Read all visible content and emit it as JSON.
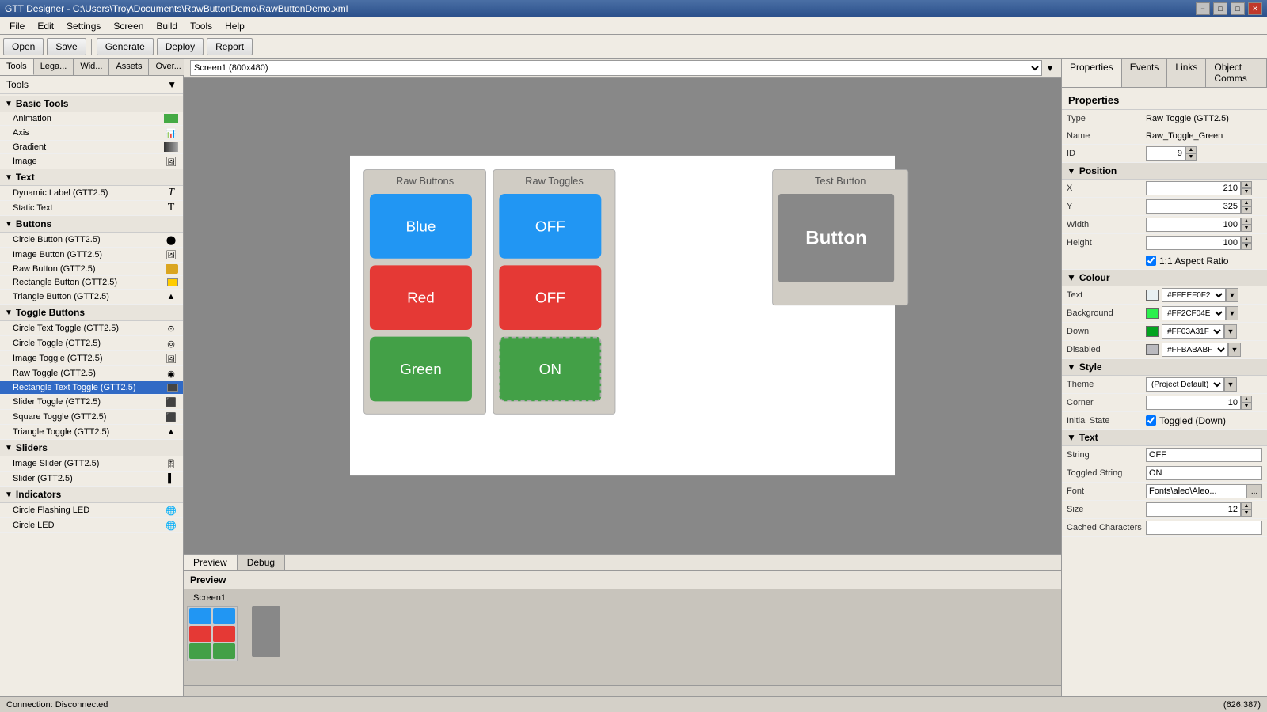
{
  "titleBar": {
    "text": "GTT Designer - C:\\Users\\Troy\\Documents\\RawButtonDemo\\RawButtonDemo.xml",
    "controls": [
      "minimize",
      "restore",
      "maximize",
      "close"
    ]
  },
  "menuBar": {
    "items": [
      "File",
      "Edit",
      "Settings",
      "Screen",
      "Build",
      "Tools",
      "Help"
    ]
  },
  "toolbar": {
    "buttons": [
      "Open",
      "Save",
      "Generate",
      "Deploy",
      "Report"
    ]
  },
  "leftPanel": {
    "tabs": [
      "Tools",
      "Lega...",
      "Wid...",
      "Assets",
      "Over..."
    ],
    "activeTab": "Tools",
    "header": "Tools",
    "categories": [
      {
        "name": "Basic Tools",
        "items": [
          "Animation",
          "Axis",
          "Gradient",
          "Image"
        ]
      },
      {
        "name": "Text",
        "items": [
          "Dynamic Label (GTT2.5)",
          "Static Text"
        ]
      },
      {
        "name": "Buttons",
        "items": [
          "Circle Button (GTT2.5)",
          "Image Button (GTT2.5)",
          "Raw Button (GTT2.5)",
          "Rectangle Button (GTT2.5)",
          "Triangle Button (GTT2.5)"
        ]
      },
      {
        "name": "Toggle Buttons",
        "items": [
          "Circle Text Toggle (GTT2.5)",
          "Circle Toggle (GTT2.5)",
          "Image Toggle (GTT2.5)",
          "Raw Toggle (GTT2.5)",
          "Rectangle Text Toggle (GTT2.5)",
          "Slider Toggle (GTT2.5)",
          "Square Toggle (GTT2.5)",
          "Triangle Toggle (GTT2.5)"
        ]
      },
      {
        "name": "Sliders",
        "items": [
          "Image Slider (GTT2.5)",
          "Slider (GTT2.5)"
        ]
      },
      {
        "name": "Indicators",
        "items": [
          "Circle Flashing LED",
          "Circle LED"
        ]
      }
    ]
  },
  "screenBar": {
    "value": "Screen1 (800x480)"
  },
  "canvas": {
    "rawButtonsTitle": "Raw Buttons",
    "rawTogglesTitle": "Raw Toggles",
    "testButtonTitle": "Test Button",
    "buttons": [
      {
        "label": "Blue",
        "color": "blue"
      },
      {
        "label": "Red",
        "color": "red"
      },
      {
        "label": "Green",
        "color": "green"
      }
    ],
    "toggles": [
      {
        "label": "OFF",
        "state": "off",
        "color": "blue"
      },
      {
        "label": "OFF",
        "state": "off",
        "color": "red"
      },
      {
        "label": "ON",
        "state": "on",
        "color": "green"
      }
    ],
    "testButton": {
      "label": "Button"
    }
  },
  "preview": {
    "tabs": [
      "Preview",
      "Debug"
    ],
    "activeTab": "Preview",
    "header": "Preview",
    "screenLabel": "Screen1"
  },
  "rightPanel": {
    "tabs": [
      "Properties",
      "Events",
      "Links",
      "Object Comms"
    ],
    "activeTab": "Properties",
    "header": "Properties",
    "properties": {
      "type": {
        "label": "Type",
        "value": "Raw Toggle (GTT2.5)"
      },
      "name": {
        "label": "Name",
        "value": "Raw_Toggle_Green"
      },
      "id": {
        "label": "ID",
        "value": "9"
      },
      "position": {
        "label": "Position",
        "x": {
          "label": "X",
          "value": "210"
        },
        "y": {
          "label": "Y",
          "value": "325"
        }
      },
      "width": {
        "label": "Width",
        "value": "100"
      },
      "height": {
        "label": "Height",
        "value": "100"
      },
      "aspectRatio": {
        "label": "1:1 Aspect Ratio",
        "checked": true
      },
      "colour": {
        "label": "Colour",
        "text": {
          "label": "Text",
          "value": "#FFEEF0F2",
          "hex": "#FFEEF0F2",
          "display": "#E8F0F2"
        },
        "background": {
          "label": "Background",
          "value": "#FF2CF04E",
          "hex": "#FF2CF04E",
          "display": "#2CF04E"
        },
        "down": {
          "label": "Down",
          "value": "#FF03A31F",
          "hex": "#FF03A31F",
          "display": "#03A31F"
        },
        "disabled": {
          "label": "Disabled",
          "value": "#FFBABABF",
          "hex": "#FFBABABF",
          "display": "#BABABF"
        }
      },
      "style": {
        "label": "Style",
        "theme": {
          "label": "Theme",
          "value": "(Project Default)"
        },
        "corner": {
          "label": "Corner",
          "value": "10"
        },
        "initialState": {
          "label": "Initial State",
          "checked": true,
          "text": "Toggled (Down)"
        }
      },
      "text": {
        "label": "Text",
        "string": {
          "label": "String",
          "value": "OFF"
        },
        "toggledString": {
          "label": "Toggled String",
          "value": "ON"
        },
        "font": {
          "label": "Font",
          "value": "Fonts\\aleo\\Aleo..."
        },
        "size": {
          "label": "Size",
          "value": "12"
        },
        "cachedCharacters": {
          "label": "Cached Characters",
          "value": ""
        }
      }
    }
  },
  "statusBar": {
    "left": "Connection: Disconnected",
    "right": "(626,387)"
  }
}
